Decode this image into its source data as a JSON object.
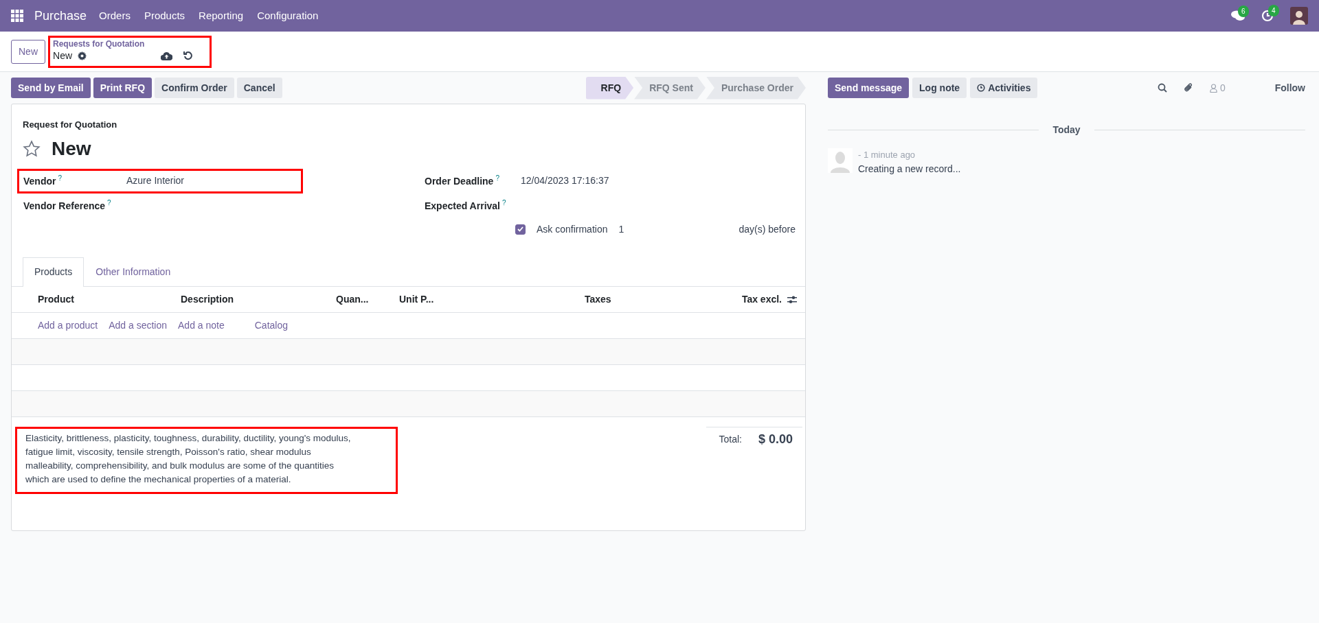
{
  "app": {
    "name": "Purchase",
    "menu": [
      "Orders",
      "Products",
      "Reporting",
      "Configuration"
    ]
  },
  "systray": [
    {
      "kind": "chat",
      "count": "6"
    },
    {
      "kind": "activity",
      "count": "4"
    }
  ],
  "new_button": "New",
  "breadcrumb": {
    "parent": "Requests for Quotation",
    "current": "New",
    "highlighted": true
  },
  "actions": [
    {
      "label": "Send by Email",
      "primary": true
    },
    {
      "label": "Print RFQ",
      "primary": true
    },
    {
      "label": "Confirm Order",
      "primary": false
    },
    {
      "label": "Cancel",
      "primary": false
    }
  ],
  "statusbar": [
    {
      "label": "RFQ",
      "selected": true
    },
    {
      "label": "RFQ Sent",
      "selected": false
    },
    {
      "label": "Purchase Order",
      "selected": false
    }
  ],
  "form": {
    "subtitle": "Request for Quotation",
    "title": "New",
    "starred": false,
    "fields_left": [
      {
        "label": "Vendor",
        "help": "?",
        "value": "Azure Interior",
        "highlighted": true
      },
      {
        "label": "Vendor Reference",
        "help": "?",
        "highlighted": false
      }
    ],
    "fields_right": [
      {
        "label": "Order Deadline",
        "help": "?",
        "value": "12/04/2023 17:16:37"
      },
      {
        "label": "Expected Arrival",
        "help": "?"
      }
    ],
    "ask_confirmation": {
      "checked": true,
      "label": "Ask confirmation",
      "days": "1",
      "suffix": "day(s) before"
    }
  },
  "tabs": [
    {
      "label": "Products",
      "selected": true
    },
    {
      "label": "Other Information",
      "selected": false
    }
  ],
  "table": {
    "columns": [
      "Product",
      "Description",
      "Quan...",
      "Unit P...",
      "Taxes",
      "Tax excl."
    ],
    "add_links": [
      "Add a product",
      "Add a section",
      "Add a note",
      "Catalog"
    ]
  },
  "note": {
    "text": "Elasticity, brittleness, plasticity, toughness, durability, ductility, young's modulus, fatigue limit, viscosity, tensile strength, Poisson's ratio, shear modulus malleability, comprehensibility, and bulk modulus are some of the quantities which are used to define the mechanical properties of a material.",
    "highlighted": true
  },
  "total": {
    "label": "Total:",
    "value": "$ 0.00"
  },
  "chatter": {
    "buttons": [
      {
        "label": "Send message",
        "kind": "primary"
      },
      {
        "label": "Log note",
        "kind": "plain"
      },
      {
        "label": "Activities",
        "kind": "activities"
      }
    ],
    "followers": "0",
    "follow": "Follow",
    "date": "Today",
    "messages": [
      {
        "time": "- 1 minute ago",
        "body": "Creating a new record..."
      }
    ]
  }
}
